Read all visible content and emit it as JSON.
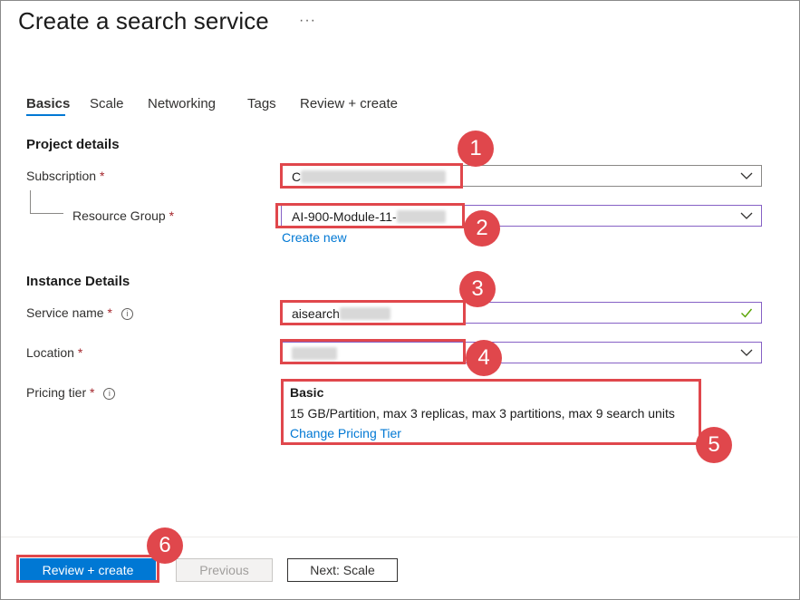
{
  "header": {
    "title": "Create a search service",
    "more_label": "···"
  },
  "tabs": [
    {
      "label": "Basics",
      "active": true
    },
    {
      "label": "Scale"
    },
    {
      "label": "Networking"
    },
    {
      "label": "Tags"
    },
    {
      "label": "Review + create"
    }
  ],
  "project_details": {
    "title": "Project details",
    "subscription": {
      "label": "Subscription",
      "required": "*",
      "value_prefix": "C"
    },
    "resource_group": {
      "label": "Resource Group",
      "required": "*",
      "value": "AI-900-Module-11-"
    },
    "create_new": "Create new"
  },
  "instance_details": {
    "title": "Instance Details",
    "service_name": {
      "label": "Service name",
      "required": "*",
      "value": "aisearch"
    },
    "location": {
      "label": "Location",
      "required": "*",
      "value": ""
    },
    "pricing_tier": {
      "label": "Pricing tier",
      "required": "*",
      "tier_name": "Basic",
      "description": "15 GB/Partition, max 3 replicas, max 3 partitions, max 9 search units",
      "change_link": "Change Pricing Tier"
    }
  },
  "footer": {
    "review_create": "Review + create",
    "previous": "Previous",
    "next": "Next: Scale"
  },
  "callouts": [
    "1",
    "2",
    "3",
    "4",
    "5",
    "6"
  ],
  "colors": {
    "accent": "#0078d4",
    "callout": "#e0474c",
    "focus_border": "#8661c5",
    "required": "#a4262c",
    "valid": "#57a300"
  }
}
